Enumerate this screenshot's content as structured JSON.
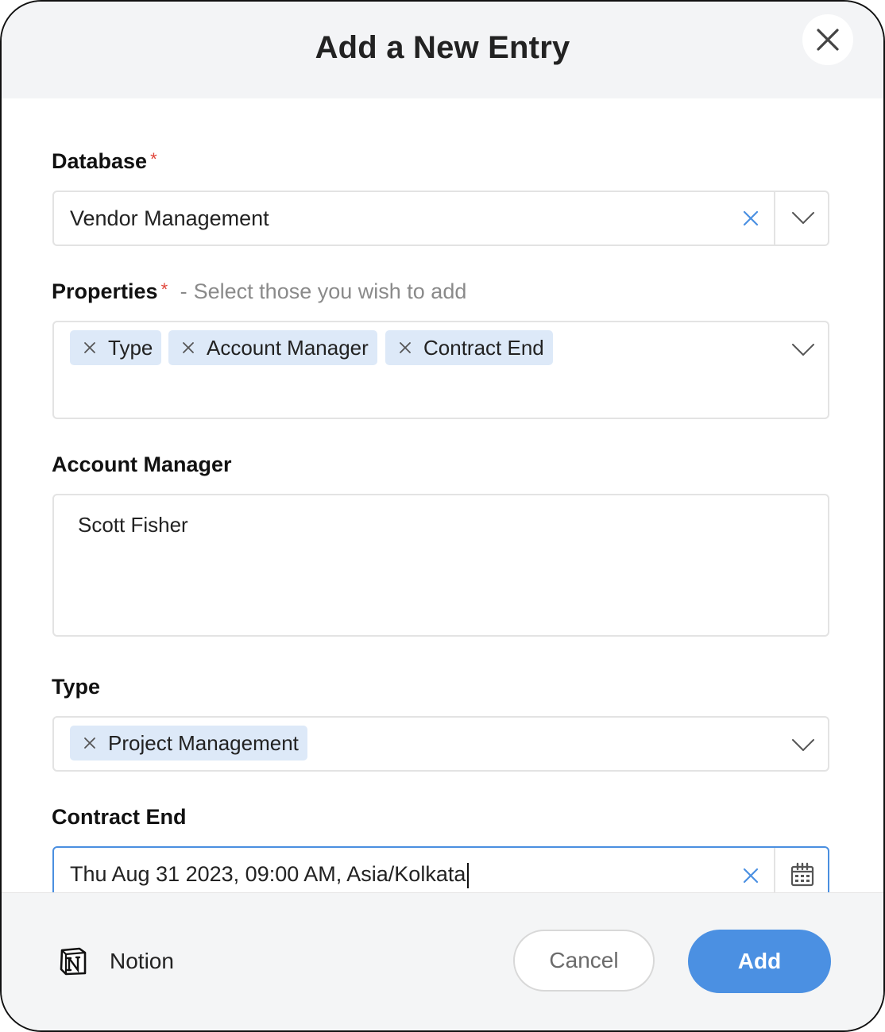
{
  "dialog": {
    "title": "Add a New Entry"
  },
  "database": {
    "label": "Database",
    "required_mark": "*",
    "value": "Vendor Management"
  },
  "properties": {
    "label": "Properties",
    "required_mark": "*",
    "separator": "-",
    "hint": "Select those you wish to add",
    "tags": [
      "Type",
      "Account Manager",
      "Contract End"
    ]
  },
  "account_manager": {
    "label": "Account Manager",
    "value": "Scott Fisher"
  },
  "type": {
    "label": "Type",
    "tags": [
      "Project Management"
    ]
  },
  "contract_end": {
    "label": "Contract End",
    "value": "Thu Aug 31 2023, 09:00 AM, Asia/Kolkata"
  },
  "footer": {
    "brand": "Notion",
    "cancel_label": "Cancel",
    "add_label": "Add"
  },
  "colors": {
    "accent": "#4b90e2",
    "tag_bg": "#dde9f8",
    "required": "#e0453a"
  },
  "icons": {
    "close": "close-icon",
    "clear": "clear-x-icon",
    "dropdown": "chevron-down-icon",
    "calendar": "calendar-icon",
    "brand": "notion-logo-icon"
  }
}
